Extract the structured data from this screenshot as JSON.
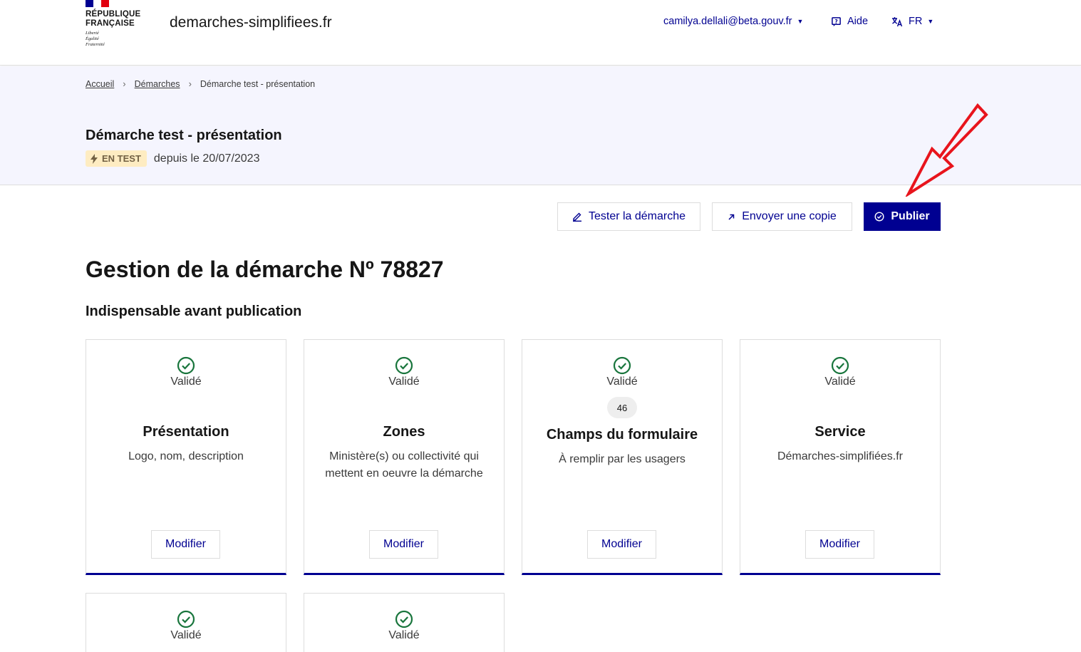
{
  "header": {
    "logo_lines": [
      "RÉPUBLIQUE",
      "FRANÇAISE"
    ],
    "motto": [
      "Liberté",
      "Égalité",
      "Fraternité"
    ],
    "site_name": "demarches-simplifiees.fr",
    "user_email": "camilya.dellali@beta.gouv.fr",
    "help_label": "Aide",
    "lang_label": "FR"
  },
  "breadcrumb": {
    "home": "Accueil",
    "demarches": "Démarches",
    "current": "Démarche test - présentation"
  },
  "band": {
    "title": "Démarche test - présentation",
    "badge": "EN TEST",
    "since": "depuis le 20/07/2023"
  },
  "actions": {
    "test": "Tester la démarche",
    "copy": "Envoyer une copie",
    "publish": "Publier"
  },
  "page_title": "Gestion de la démarche Nº 78827",
  "section_title": "Indispensable avant publication",
  "cards": [
    {
      "status": "Validé",
      "title": "Présentation",
      "description": "Logo, nom, description",
      "button": "Modifier"
    },
    {
      "status": "Validé",
      "title": "Zones",
      "description": "Ministère(s) ou collectivité qui mettent en oeuvre la démarche",
      "button": "Modifier"
    },
    {
      "status": "Validé",
      "count": "46",
      "title": "Champs du formulaire",
      "description": "À remplir par les usagers",
      "button": "Modifier"
    },
    {
      "status": "Validé",
      "title": "Service",
      "description": "Démarches-simplifiées.fr",
      "button": "Modifier"
    },
    {
      "status": "Validé"
    },
    {
      "status": "Validé"
    }
  ],
  "colors": {
    "primary": "#000091",
    "success": "#18753c",
    "badge_bg": "#feecc2",
    "annotation": "#e8141c"
  },
  "icons": {
    "check": "check-circle-icon",
    "badge": "lightning-icon",
    "help": "help-bubble-icon",
    "lang": "translate-icon",
    "test": "pencil-icon",
    "copy": "arrow-up-right-icon",
    "publish": "check-circle-icon"
  }
}
